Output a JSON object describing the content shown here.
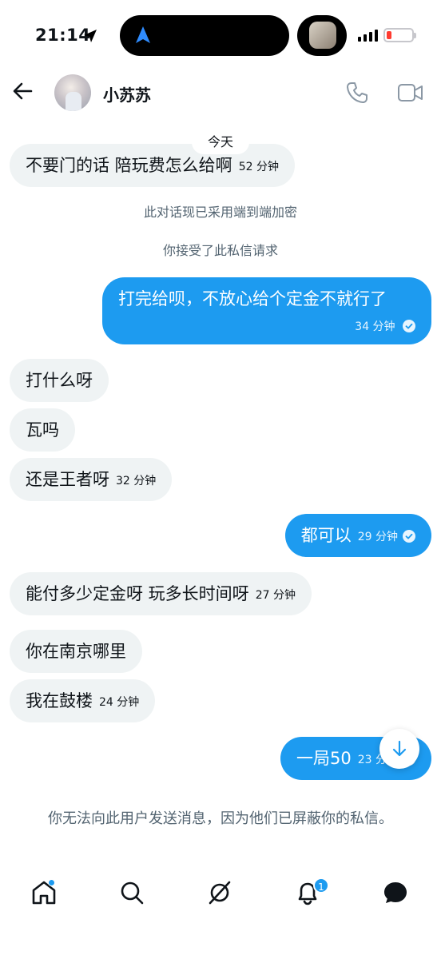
{
  "status_bar": {
    "time": "21:14",
    "battery_level": 0.1
  },
  "header": {
    "contact_name": "小苏苏",
    "icons": [
      "back-arrow-icon",
      "avatar",
      "phone-icon",
      "video-icon"
    ]
  },
  "chat": {
    "date_label": "今天",
    "system_messages": [
      "此对话现已采用端到端加密",
      "你接受了此私信请求"
    ],
    "messages": [
      {
        "side": "in",
        "text": "不要门的话 陪玩费怎么给啊",
        "time": "52 分钟"
      },
      {
        "side": "out",
        "text": "打完给呗，不放心给个定金不就行了",
        "time": "34 分钟"
      },
      {
        "side": "in",
        "text": "打什么呀",
        "time": ""
      },
      {
        "side": "in",
        "text": "瓦吗",
        "time": ""
      },
      {
        "side": "in",
        "text": "还是王者呀",
        "time": "32 分钟"
      },
      {
        "side": "out",
        "text": "都可以",
        "time": "29 分钟"
      },
      {
        "side": "in",
        "text": "能付多少定金呀 玩多长时间呀",
        "time": "27 分钟"
      },
      {
        "side": "in",
        "text": "你在南京哪里",
        "time": ""
      },
      {
        "side": "in",
        "text": "我在鼓楼",
        "time": "24 分钟"
      },
      {
        "side": "out",
        "text": "一局50",
        "time": "23 分钟"
      }
    ],
    "blocked_notice": "你无法向此用户发送消息，因为他们已屏蔽你的私信。"
  },
  "bottom_nav": {
    "items": [
      "home-icon",
      "search-icon",
      "grok-icon",
      "notifications-icon",
      "messages-icon"
    ],
    "notification_count": "1"
  },
  "colors": {
    "accent": "#1d9bf0",
    "incoming_bubble": "#eff3f4",
    "secondary_text": "#536471"
  }
}
